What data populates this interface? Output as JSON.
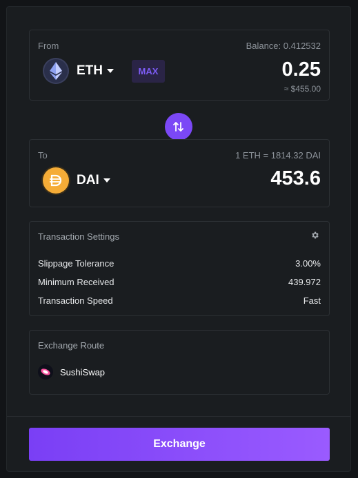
{
  "from": {
    "label": "From",
    "balance": "Balance: 0.412532",
    "token": "ETH",
    "max_label": "MAX",
    "amount": "0.25",
    "usd_value": "≈ $455.00"
  },
  "to": {
    "label": "To",
    "rate": "1 ETH = 1814.32 DAI",
    "token": "DAI",
    "amount": "453.6"
  },
  "settings": {
    "title": "Transaction Settings",
    "rows": [
      {
        "label": "Slippage Tolerance",
        "value": "3.00%"
      },
      {
        "label": "Minimum Received",
        "value": "439.972"
      },
      {
        "label": "Transaction Speed",
        "value": "Fast"
      }
    ]
  },
  "route": {
    "title": "Exchange Route",
    "name": "SushiSwap"
  },
  "exchange_button": "Exchange",
  "icons": {
    "eth": "ethereum-icon",
    "dai": "dai-icon",
    "swap": "swap-arrows-icon",
    "settings": "gear-icon",
    "route": "sushiswap-icon"
  },
  "colors": {
    "accent": "#7b48f6",
    "dai": "#f5ac37",
    "max_text": "#7d5cf6"
  }
}
